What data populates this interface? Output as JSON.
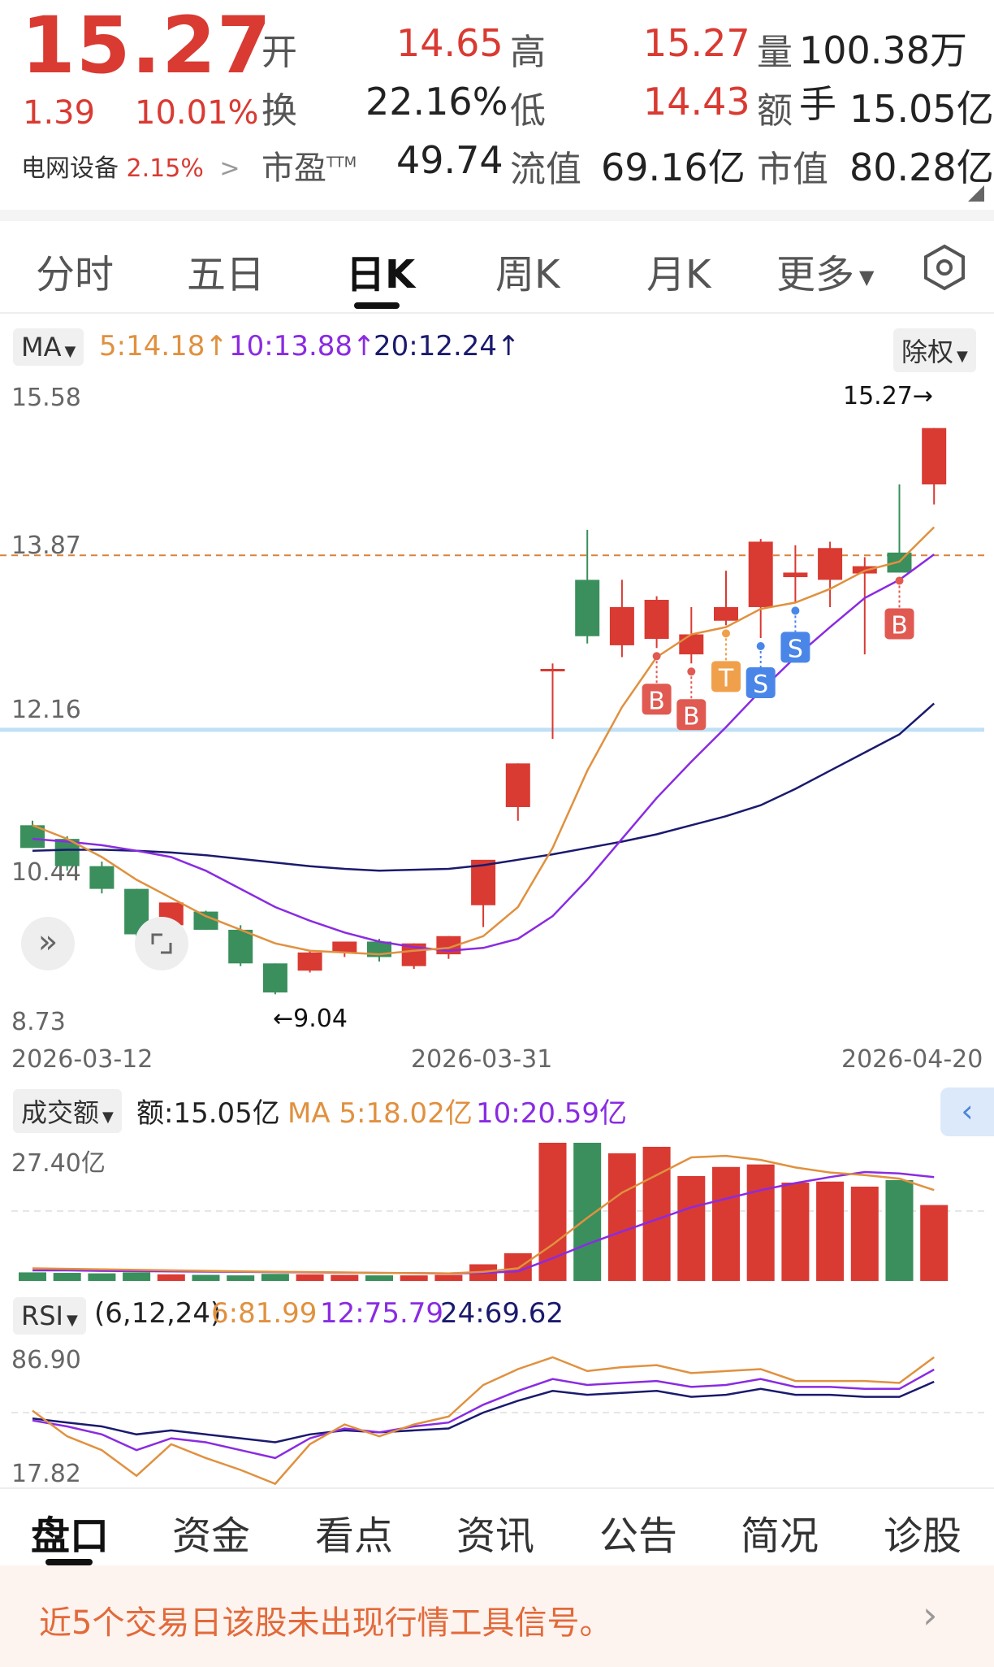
{
  "quote": {
    "price": "15.27",
    "change": "1.39",
    "change_pct": "10.01%",
    "sector_name": "电网设备",
    "sector_pct": "2.15%",
    "open_label": "开",
    "open": "14.65",
    "high_label": "高",
    "high": "15.27",
    "volume_label": "量",
    "volume": "100.38万手",
    "turnover_label": "换",
    "turnover": "22.16%",
    "low_label": "低",
    "low": "14.43",
    "amount_label": "额",
    "amount": "15.05亿",
    "pe_label": "市盈",
    "pe_sup": "TTM",
    "pe": "49.74",
    "float_label": "流值",
    "float": "69.16亿",
    "mcap_label": "市值",
    "mcap": "80.28亿"
  },
  "tabs": [
    {
      "label": "分时"
    },
    {
      "label": "五日"
    },
    {
      "label": "日K"
    },
    {
      "label": "周K"
    },
    {
      "label": "月K"
    },
    {
      "label": "更多"
    }
  ],
  "ma": {
    "selector": "MA",
    "ma5": "5:14.18↑",
    "ma10": "10:13.88↑",
    "ma20": "20:12.24↑",
    "adjust": "除权",
    "colors": {
      "ma5": "#e0913f",
      "ma10": "#8a2be2",
      "ma20": "#1a1a6e"
    }
  },
  "price_axis": [
    "15.58",
    "13.87",
    "12.16",
    "10.44",
    "8.73"
  ],
  "date_axis": [
    "2026-03-12",
    "2026-03-31",
    "2026-04-20"
  ],
  "annotations": {
    "high": "15.27→",
    "low": "←9.04"
  },
  "volume_panel": {
    "selector": "成交额",
    "amount": "额:15.05亿",
    "ma5": "MA 5:18.02亿",
    "ma10": "10:20.59亿",
    "axis_top": "27.40亿"
  },
  "rsi_panel": {
    "selector": "RSI",
    "params": "(6,12,24)",
    "rsi6": "6:81.99",
    "rsi12": "12:75.79",
    "rsi24": "24:69.62",
    "axis_top": "86.90",
    "axis_bottom": "17.82"
  },
  "bottom_tabs": [
    {
      "label": "盘口"
    },
    {
      "label": "资金"
    },
    {
      "label": "看点"
    },
    {
      "label": "资讯"
    },
    {
      "label": "公告"
    },
    {
      "label": "简况"
    },
    {
      "label": "诊股"
    }
  ],
  "notice": "近5个交易日该股未出现行情工具信号。",
  "signals": [
    "B",
    "B",
    "T",
    "S",
    "S",
    "B"
  ],
  "colors": {
    "up": "#d93a32",
    "down": "#3a8f5c"
  },
  "chart_data": {
    "type": "candlestick",
    "dates_labeled": [
      "2026-03-12",
      "2026-03-31",
      "2026-04-20"
    ],
    "candles": [
      {
        "o": 10.9,
        "h": 10.95,
        "l": 10.65,
        "c": 10.65
      },
      {
        "o": 10.75,
        "h": 10.78,
        "l": 10.4,
        "c": 10.45
      },
      {
        "o": 10.45,
        "h": 10.5,
        "l": 10.15,
        "c": 10.2
      },
      {
        "o": 10.2,
        "h": 10.2,
        "l": 9.68,
        "c": 9.7
      },
      {
        "o": 9.8,
        "h": 10.05,
        "l": 9.78,
        "c": 10.05
      },
      {
        "o": 9.95,
        "h": 9.96,
        "l": 9.75,
        "c": 9.75
      },
      {
        "o": 9.75,
        "h": 9.8,
        "l": 9.35,
        "c": 9.38
      },
      {
        "o": 9.38,
        "h": 9.38,
        "l": 9.04,
        "c": 9.06
      },
      {
        "o": 9.3,
        "h": 9.52,
        "l": 9.28,
        "c": 9.5
      },
      {
        "o": 9.5,
        "h": 9.62,
        "l": 9.45,
        "c": 9.62
      },
      {
        "o": 9.62,
        "h": 9.65,
        "l": 9.4,
        "c": 9.45
      },
      {
        "o": 9.35,
        "h": 9.6,
        "l": 9.32,
        "c": 9.6
      },
      {
        "o": 9.48,
        "h": 9.68,
        "l": 9.43,
        "c": 9.68
      },
      {
        "o": 10.02,
        "h": 10.5,
        "l": 9.78,
        "c": 10.52
      },
      {
        "o": 11.1,
        "h": 11.58,
        "l": 10.95,
        "c": 11.58
      },
      {
        "o": 12.62,
        "h": 12.68,
        "l": 11.85,
        "c": 12.62
      },
      {
        "o": 13.6,
        "h": 14.15,
        "l": 12.9,
        "c": 12.98
      },
      {
        "o": 12.88,
        "h": 13.6,
        "l": 12.75,
        "c": 13.3
      },
      {
        "o": 12.95,
        "h": 13.42,
        "l": 12.85,
        "c": 13.38
      },
      {
        "o": 12.78,
        "h": 13.3,
        "l": 12.68,
        "c": 13.0
      },
      {
        "o": 13.15,
        "h": 13.7,
        "l": 13.1,
        "c": 13.3
      },
      {
        "o": 13.3,
        "h": 14.05,
        "l": 12.96,
        "c": 14.02
      },
      {
        "o": 13.63,
        "h": 13.98,
        "l": 13.35,
        "c": 13.68
      },
      {
        "o": 13.6,
        "h": 14.02,
        "l": 13.3,
        "c": 13.95
      },
      {
        "o": 13.67,
        "h": 13.85,
        "l": 12.78,
        "c": 13.75
      },
      {
        "o": 13.9,
        "h": 14.65,
        "l": 13.68,
        "c": 13.68
      },
      {
        "o": 14.65,
        "h": 15.27,
        "l": 14.43,
        "c": 15.27
      }
    ],
    "ma5": [
      10.9,
      10.75,
      10.55,
      10.3,
      10.1,
      9.9,
      9.75,
      9.6,
      9.52,
      9.5,
      9.48,
      9.52,
      9.55,
      9.68,
      10.0,
      10.65,
      11.5,
      12.2,
      12.75,
      13.0,
      13.08,
      13.28,
      13.35,
      13.5,
      13.7,
      13.8,
      14.18
    ],
    "ma10": [
      10.75,
      10.72,
      10.68,
      10.62,
      10.55,
      10.4,
      10.2,
      10.0,
      9.85,
      9.72,
      9.62,
      9.56,
      9.52,
      9.55,
      9.65,
      9.9,
      10.3,
      10.75,
      11.2,
      11.6,
      11.98,
      12.38,
      12.75,
      13.08,
      13.4,
      13.6,
      13.88
    ],
    "ma20": [
      10.62,
      10.63,
      10.63,
      10.62,
      10.6,
      10.57,
      10.53,
      10.49,
      10.45,
      10.42,
      10.4,
      10.41,
      10.42,
      10.46,
      10.52,
      10.58,
      10.65,
      10.72,
      10.8,
      10.9,
      11.0,
      11.12,
      11.3,
      11.5,
      11.7,
      11.9,
      12.24
    ],
    "reference_price": 13.87,
    "support_price": 11.95,
    "y_range": [
      8.73,
      15.58
    ],
    "amount_yi": [
      1.7,
      1.6,
      1.5,
      1.7,
      1.3,
      1.2,
      1.1,
      1.4,
      1.3,
      1.2,
      1.1,
      1.1,
      1.2,
      3.3,
      5.5,
      27.4,
      27.4,
      25.3,
      26.6,
      20.8,
      22.6,
      23.1,
      19.5,
      19.7,
      18.7,
      20.0,
      15.05
    ],
    "amount_ma5": [
      2.5,
      2.4,
      2.3,
      2.2,
      2.1,
      2.0,
      1.9,
      1.8,
      1.75,
      1.7,
      1.6,
      1.55,
      1.5,
      1.8,
      2.5,
      7.2,
      12.5,
      17.5,
      21.0,
      24.5,
      24.8,
      24.0,
      22.5,
      21.5,
      21.0,
      20.3,
      18.02
    ],
    "amount_ma10": [
      2.1,
      2.1,
      2.0,
      1.95,
      1.9,
      1.85,
      1.8,
      1.75,
      1.7,
      1.65,
      1.6,
      1.55,
      1.5,
      1.6,
      1.9,
      4.5,
      7.3,
      9.8,
      12.2,
      14.6,
      16.3,
      18.0,
      19.4,
      20.6,
      21.6,
      21.3,
      20.59
    ],
    "rsi6": [
      55,
      42,
      35,
      22,
      38,
      31,
      25,
      18,
      38,
      48,
      42,
      48,
      52,
      68,
      76,
      82,
      75,
      77,
      78,
      74,
      75,
      76,
      70,
      70,
      70,
      69,
      81.99
    ],
    "rsi12": [
      50,
      47,
      43,
      35,
      41,
      39,
      35,
      31,
      41,
      46,
      44,
      47,
      49,
      58,
      65,
      71,
      68,
      69,
      70,
      67,
      68,
      71,
      67,
      67,
      66,
      66,
      75.79
    ],
    "rsi24": [
      51,
      49,
      47,
      43,
      45,
      43,
      41,
      39,
      43,
      45,
      44,
      45,
      46,
      54,
      60,
      65,
      63,
      64,
      65,
      62,
      63,
      66,
      63,
      63,
      62,
      62,
      69.62
    ],
    "rsi_range": [
      17.82,
      86.9
    ]
  }
}
